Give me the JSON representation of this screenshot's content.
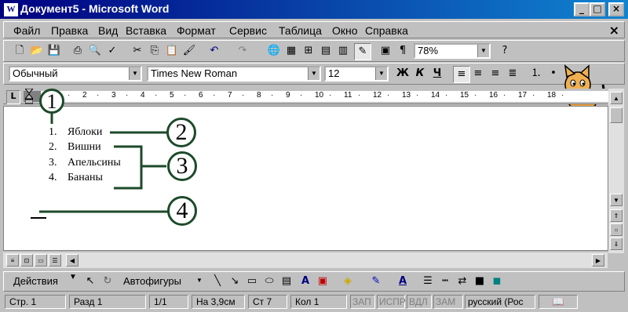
{
  "window": {
    "title": "Документ5 - Microsoft Word",
    "app_icon_letter": "W"
  },
  "menu": [
    "Файл",
    "Правка",
    "Вид",
    "Вставка",
    "Формат",
    "Сервис",
    "Таблица",
    "Окно",
    "Справка"
  ],
  "toolbar_standard": {
    "zoom": "78%"
  },
  "toolbar_format": {
    "style": "Обычный",
    "font": "Times New Roman",
    "size": "12",
    "bold": "Ж",
    "italic": "К",
    "underline": "Ч"
  },
  "ruler": {
    "tab_stop_label": "L",
    "ticks": [
      "1",
      "2",
      "3",
      "4",
      "5",
      "6",
      "7",
      "8",
      "9",
      "10",
      "11",
      "12",
      "13",
      "14",
      "15",
      "16",
      "17",
      "18"
    ]
  },
  "document": {
    "list": [
      {
        "num": "1.",
        "text": "Яблоки"
      },
      {
        "num": "2.",
        "text": "Вишни"
      },
      {
        "num": "3.",
        "text": "Апельсины"
      },
      {
        "num": "4.",
        "text": "Бананы"
      }
    ]
  },
  "callouts": [
    "1",
    "2",
    "3",
    "4"
  ],
  "drawing_toolbar": {
    "actions": "Действия",
    "autoshapes": "Автофигуры"
  },
  "status": {
    "page": "Стр. 1",
    "section": "Разд 1",
    "pages": "1/1",
    "at": "На 3,9см",
    "line": "Ст 7",
    "col": "Кол 1",
    "rec": "ЗАП",
    "trk": "ИСПР",
    "ext": "ВДЛ",
    "ovr": "ЗАМ",
    "lang": "русский (Рос"
  }
}
